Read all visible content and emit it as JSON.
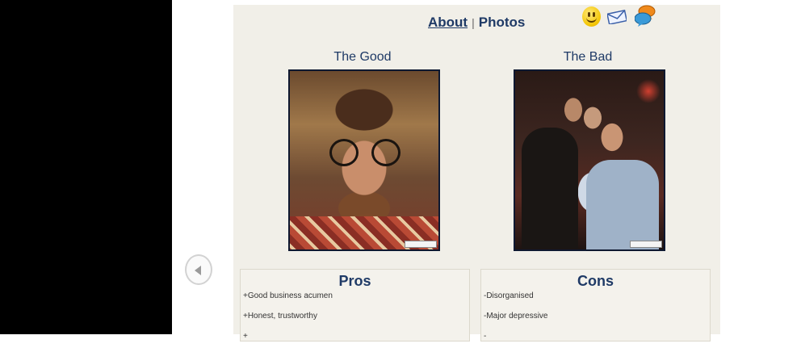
{
  "nav": {
    "about_label": "About",
    "separator": "|",
    "photos_label": "Photos"
  },
  "header_icons": [
    "smiley-icon",
    "envelope-icon",
    "chat-bubbles-icon"
  ],
  "photos": {
    "good_title": "The Good",
    "bad_title": "The Bad"
  },
  "pros": {
    "title": "Pros",
    "items": [
      "+Good business acumen",
      "+Honest, trustworthy",
      "+"
    ]
  },
  "cons": {
    "title": "Cons",
    "items": [
      "-Disorganised",
      "-Major depressive",
      "-"
    ]
  },
  "colors": {
    "panel_bg": "#f1efe8",
    "heading_blue": "#1f3a66",
    "left_bar": "#000000"
  }
}
